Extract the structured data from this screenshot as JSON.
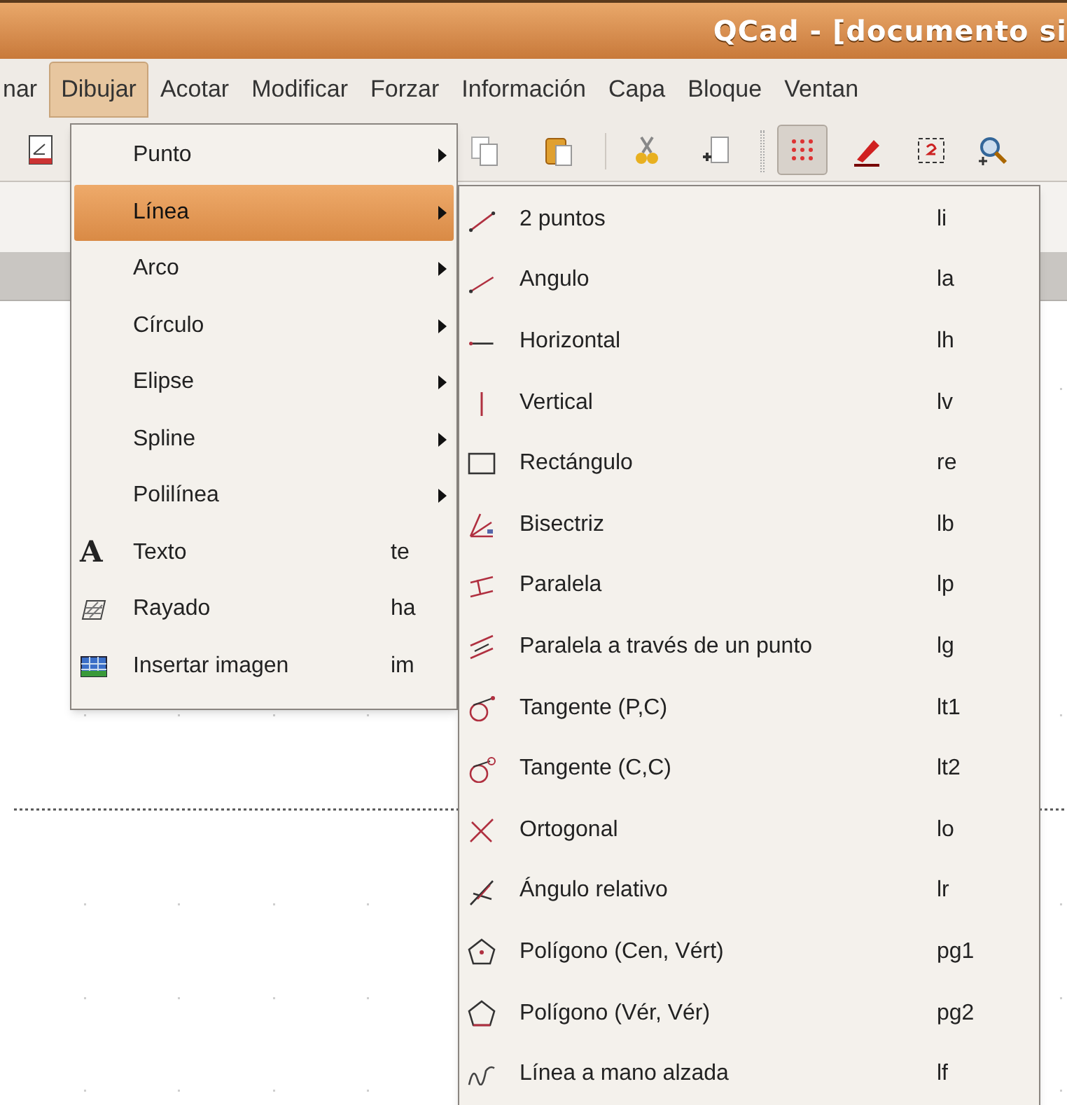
{
  "window": {
    "title": "QCad - [documento si"
  },
  "menubar": [
    {
      "label": "nar",
      "selected": false
    },
    {
      "label": "Dibujar",
      "selected": true
    },
    {
      "label": "Acotar",
      "selected": false
    },
    {
      "label": "Modificar",
      "selected": false
    },
    {
      "label": "Forzar",
      "selected": false
    },
    {
      "label": "Información",
      "selected": false
    },
    {
      "label": "Capa",
      "selected": false
    },
    {
      "label": "Bloque",
      "selected": false
    },
    {
      "label": "Ventan",
      "selected": false
    }
  ],
  "toolbar": [
    {
      "pressed": false
    },
    {
      "pressed": false
    },
    {
      "pressed": false
    },
    {
      "pressed": false
    },
    {
      "pressed": false
    },
    {
      "pressed": true
    },
    {
      "pressed": false
    },
    {
      "pressed": false
    },
    {
      "pressed": false
    }
  ],
  "draw_menu": [
    {
      "kind": "submenu",
      "label": "Punto",
      "selected": false
    },
    {
      "kind": "submenu",
      "label": "Línea",
      "selected": true
    },
    {
      "kind": "submenu",
      "label": "Arco",
      "selected": false
    },
    {
      "kind": "submenu",
      "label": "Círculo",
      "selected": false
    },
    {
      "kind": "submenu",
      "label": "Elipse",
      "selected": false
    },
    {
      "kind": "submenu",
      "label": "Spline",
      "selected": false
    },
    {
      "kind": "submenu",
      "label": "Polilínea",
      "selected": false
    },
    {
      "kind": "action",
      "glyph": "A",
      "label": "Texto",
      "shortcut": "te",
      "selected": false
    },
    {
      "kind": "action",
      "label": "Rayado",
      "shortcut": "ha",
      "selected": false
    },
    {
      "kind": "action",
      "label": "Insertar imagen",
      "shortcut": "im",
      "selected": false
    }
  ],
  "line_submenu": [
    {
      "label": "2 puntos",
      "shortcut": "li"
    },
    {
      "label": "Angulo",
      "shortcut": "la"
    },
    {
      "label": "Horizontal",
      "shortcut": "lh"
    },
    {
      "label": "Vertical",
      "shortcut": "lv"
    },
    {
      "label": "Rectángulo",
      "shortcut": "re"
    },
    {
      "label": "Bisectriz",
      "shortcut": "lb"
    },
    {
      "label": "Paralela",
      "shortcut": "lp"
    },
    {
      "label": "Paralela a través de un punto",
      "shortcut": "lg"
    },
    {
      "label": "Tangente (P,C)",
      "shortcut": "lt1"
    },
    {
      "label": "Tangente (C,C)",
      "shortcut": "lt2"
    },
    {
      "label": "Ortogonal",
      "shortcut": "lo"
    },
    {
      "label": "Ángulo relativo",
      "shortcut": "lr"
    },
    {
      "label": "Polígono (Cen, Vért)",
      "shortcut": "pg1"
    },
    {
      "label": "Polígono (Vér, Vér)",
      "shortcut": "pg2"
    },
    {
      "label": "Línea a mano alzada",
      "shortcut": "lf"
    }
  ]
}
